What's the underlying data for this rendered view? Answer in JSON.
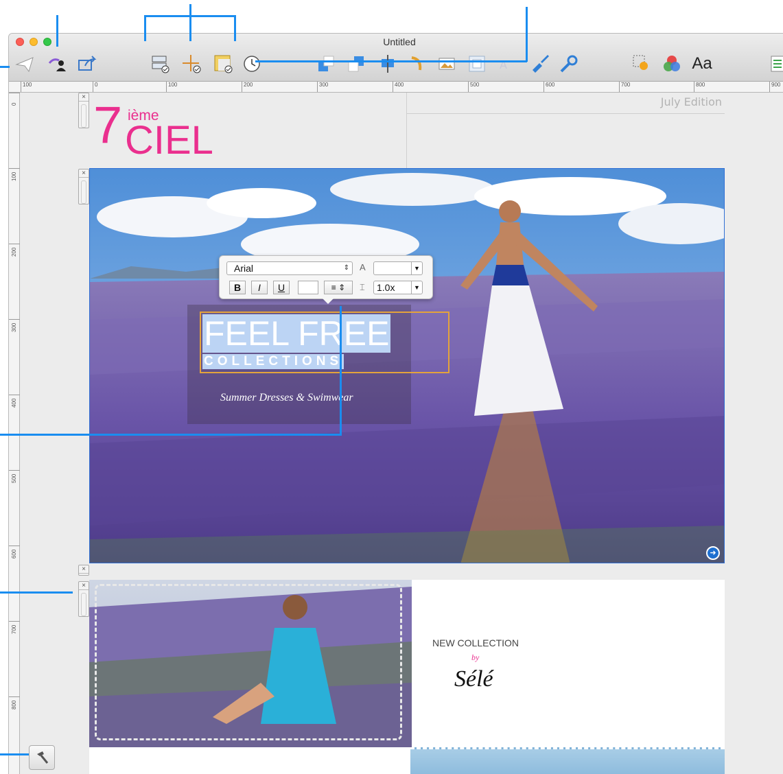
{
  "window": {
    "title": "Untitled"
  },
  "toolbar": {
    "icons": [
      "send-icon",
      "share-user-icon",
      "export-icon",
      "layout-check-icon",
      "position-check-icon",
      "guide-check-icon",
      "clock-icon",
      "bring-forward-icon",
      "group-icon",
      "align-icon",
      "rotate-icon",
      "image-icon",
      "frame-icon",
      "brush-icon",
      "tools-icon",
      "image-effect-icon",
      "colors-icon",
      "fonts-icon",
      "inspector-icon"
    ],
    "fonts_label": "Aa"
  },
  "ruler": {
    "horizontal": [
      "100",
      "0",
      "100",
      "200",
      "300",
      "400",
      "500",
      "600",
      "700",
      "800",
      "900"
    ],
    "vertical": [
      "0",
      "100",
      "200",
      "300",
      "400",
      "500",
      "600",
      "700",
      "800"
    ]
  },
  "header": {
    "logo_number": "7",
    "logo_superscript": "ième",
    "logo_word": "CIEL",
    "edition": "July Edition"
  },
  "hero": {
    "title": "FEEL FREE",
    "subtitle": "COLLECTIONS",
    "tagline": "Summer Dresses & Swimwear"
  },
  "format_popover": {
    "font": "Arial",
    "bold": "B",
    "italic": "I",
    "underline": "U",
    "line_spacing": "1.0x"
  },
  "section2": {
    "heading": "NEW COLLECTION",
    "by": "by",
    "designer": "Sélé"
  },
  "colors": {
    "brand_pink": "#ea2f8e",
    "selection_blue": "#2f6fd4",
    "callout_blue": "#1a8df0"
  }
}
